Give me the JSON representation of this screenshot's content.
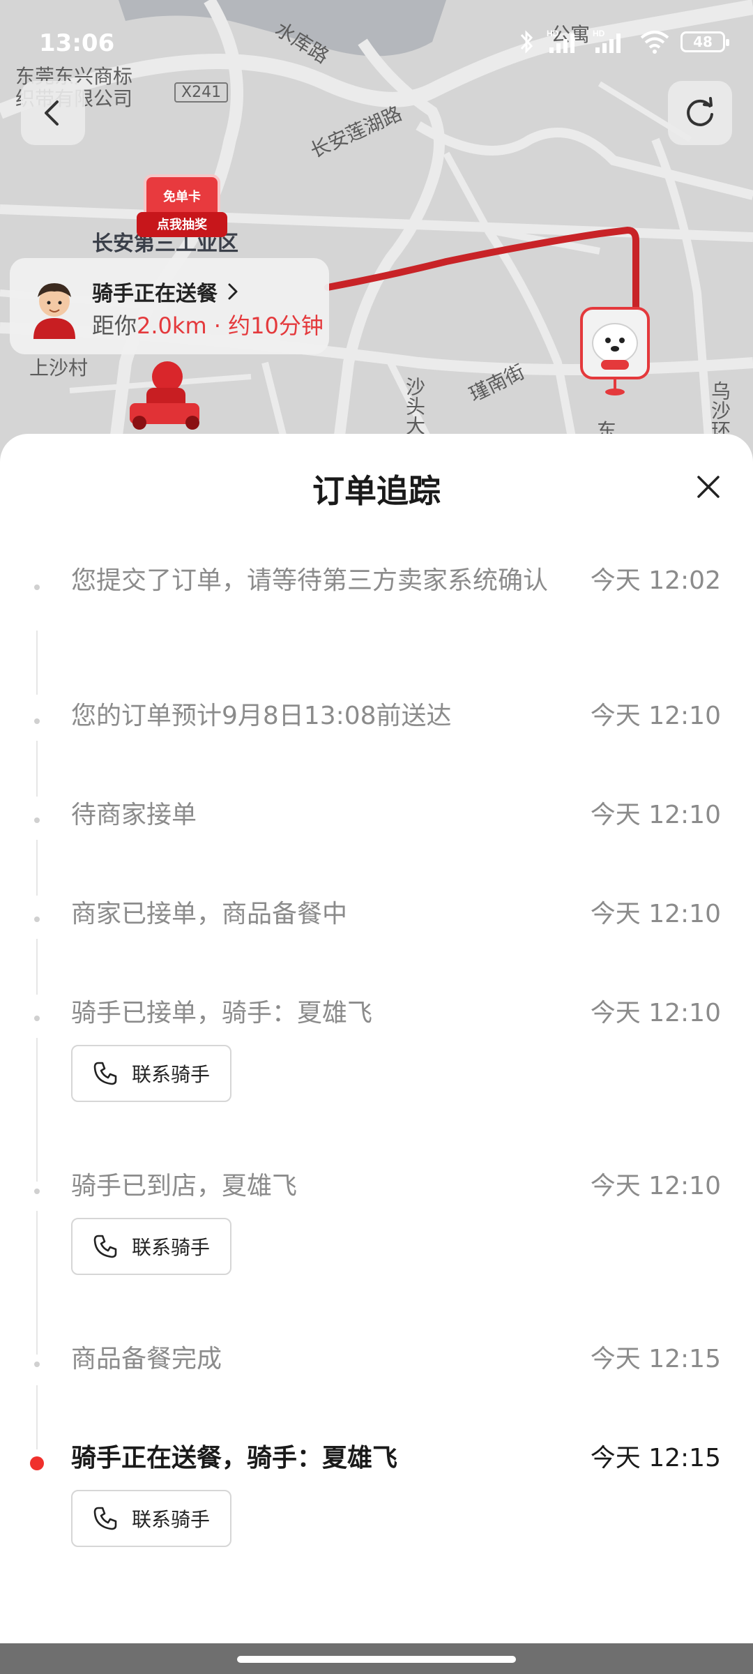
{
  "status_bar": {
    "time": "13:06",
    "battery": "48",
    "icons": [
      "bluetooth-icon",
      "signal-hd-1-icon",
      "signal-hd-2-icon",
      "wifi-icon",
      "battery-icon"
    ]
  },
  "map": {
    "labels": {
      "shuiku_road": "水库路",
      "company_line1": "东莞东兴商标",
      "company_line2": "织带有限公司",
      "x241": "X241",
      "changan_lianhu": "长安莲湖路",
      "industrial_zone": "长安第三工业区",
      "shangsha_village": "上沙村",
      "shatou": "沙头大",
      "jinnan_street": "瑾南街",
      "wusha": "乌沙环",
      "dong": "东",
      "top_right": "公寓"
    },
    "promo": {
      "card_text": "免单卡",
      "ribbon_text": "点我抽奖"
    },
    "rider_card": {
      "title": "骑手正在送餐",
      "distance_prefix": "距你",
      "distance_highlight": "2.0km · 约10分钟"
    },
    "route_color": "#d9262b"
  },
  "sheet": {
    "title": "订单追踪",
    "contact_label": "联系骑手",
    "events": [
      {
        "text": "您提交了订单，请等待第三方卖家系统确认",
        "time": "今天 12:02",
        "active": false
      },
      {
        "text": "您的订单预计9月8日13:08前送达",
        "time": "今天 12:10",
        "active": false
      },
      {
        "text": "待商家接单",
        "time": "今天 12:10",
        "active": false
      },
      {
        "text": "商家已接单，商品备餐中",
        "time": "今天 12:10",
        "active": false
      },
      {
        "text": "骑手已接单，骑手：夏雄飞",
        "time": "今天 12:10",
        "active": false
      },
      {
        "text": "骑手已到店，夏雄飞",
        "time": "今天 12:10",
        "active": false
      },
      {
        "text": "商品备餐完成",
        "time": "今天 12:15",
        "active": false
      },
      {
        "text": "骑手正在送餐，骑手：夏雄飞",
        "time": "今天 12:15",
        "active": true
      }
    ]
  },
  "colors": {
    "accent_red": "#e4393c",
    "active_dot": "#f0302c",
    "muted_text": "#8b8b8b"
  }
}
